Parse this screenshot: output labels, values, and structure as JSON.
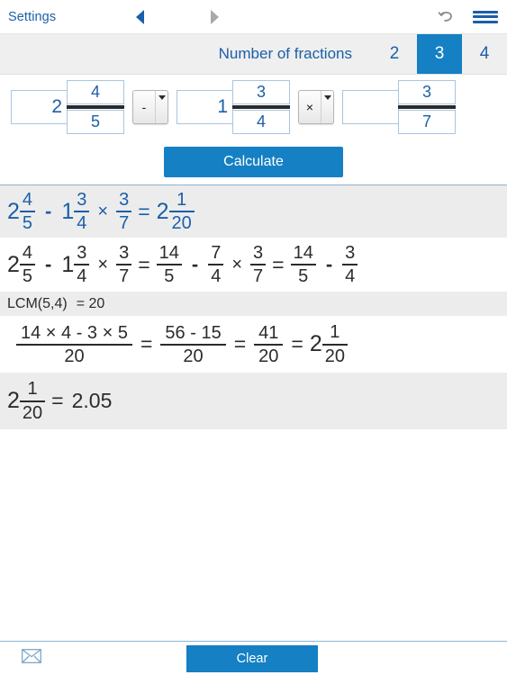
{
  "navbar": {
    "settings_label": "Settings",
    "back_icon": "back-triangle-icon",
    "forward_icon": "forward-triangle-icon",
    "undo_icon": "undo-icon",
    "menu_icon": "hamburger-menu-icon",
    "accent_color": "#1b5fa8"
  },
  "fraction_count": {
    "label": "Number of fractions",
    "options": [
      "2",
      "3",
      "4"
    ],
    "selected": "3",
    "selected_bg": "#1580c4"
  },
  "inputs": {
    "terms": [
      {
        "whole": "2",
        "numerator": "4",
        "denominator": "5"
      },
      {
        "whole": "1",
        "numerator": "3",
        "denominator": "4"
      },
      {
        "whole": "",
        "numerator": "3",
        "denominator": "7"
      }
    ],
    "operators": [
      {
        "symbol": "-",
        "caret": "dropdown-caret-icon"
      },
      {
        "symbol": "×",
        "caret": "dropdown-caret-icon"
      }
    ]
  },
  "calculate": {
    "label": "Calculate"
  },
  "results": {
    "row1": {
      "t1_whole": "2",
      "t1_num": "4",
      "t1_den": "5",
      "op1": "-",
      "t2_whole": "1",
      "t2_num": "3",
      "t2_den": "4",
      "op2": "×",
      "t3_num": "3",
      "t3_den": "7",
      "eq": "=",
      "r_whole": "2",
      "r_num": "1",
      "r_den": "20"
    },
    "row2": {
      "t1_whole": "2",
      "t1_num": "4",
      "t1_den": "5",
      "op1": "-",
      "t2_whole": "1",
      "t2_num": "3",
      "t2_den": "4",
      "op2": "×",
      "t3_num": "3",
      "t3_den": "7",
      "eq1": "=",
      "i1_num": "14",
      "i1_den": "5",
      "op3": "-",
      "i2_num": "7",
      "i2_den": "4",
      "op4": "×",
      "i3_num": "3",
      "i3_den": "7",
      "eq2": "=",
      "f1_num": "14",
      "f1_den": "5",
      "op5": "-",
      "f2_num": "3",
      "f2_den": "4"
    },
    "lcm": {
      "text": "LCM(5,4)",
      "eq": "= 20"
    },
    "row4": {
      "a_num": "14 × 4  -  3 × 5",
      "a_den": "20",
      "eq1": "=",
      "b_num": "56  -  15",
      "b_den": "20",
      "eq2": "=",
      "c_num": "41",
      "c_den": "20",
      "eq3": "=",
      "d_whole": "2",
      "d_num": "1",
      "d_den": "20"
    },
    "row5": {
      "whole": "2",
      "num": "1",
      "den": "20",
      "eq": "=",
      "decimal": "2.05"
    }
  },
  "bottombar": {
    "mail_icon": "envelope-icon",
    "clear_label": "Clear"
  }
}
